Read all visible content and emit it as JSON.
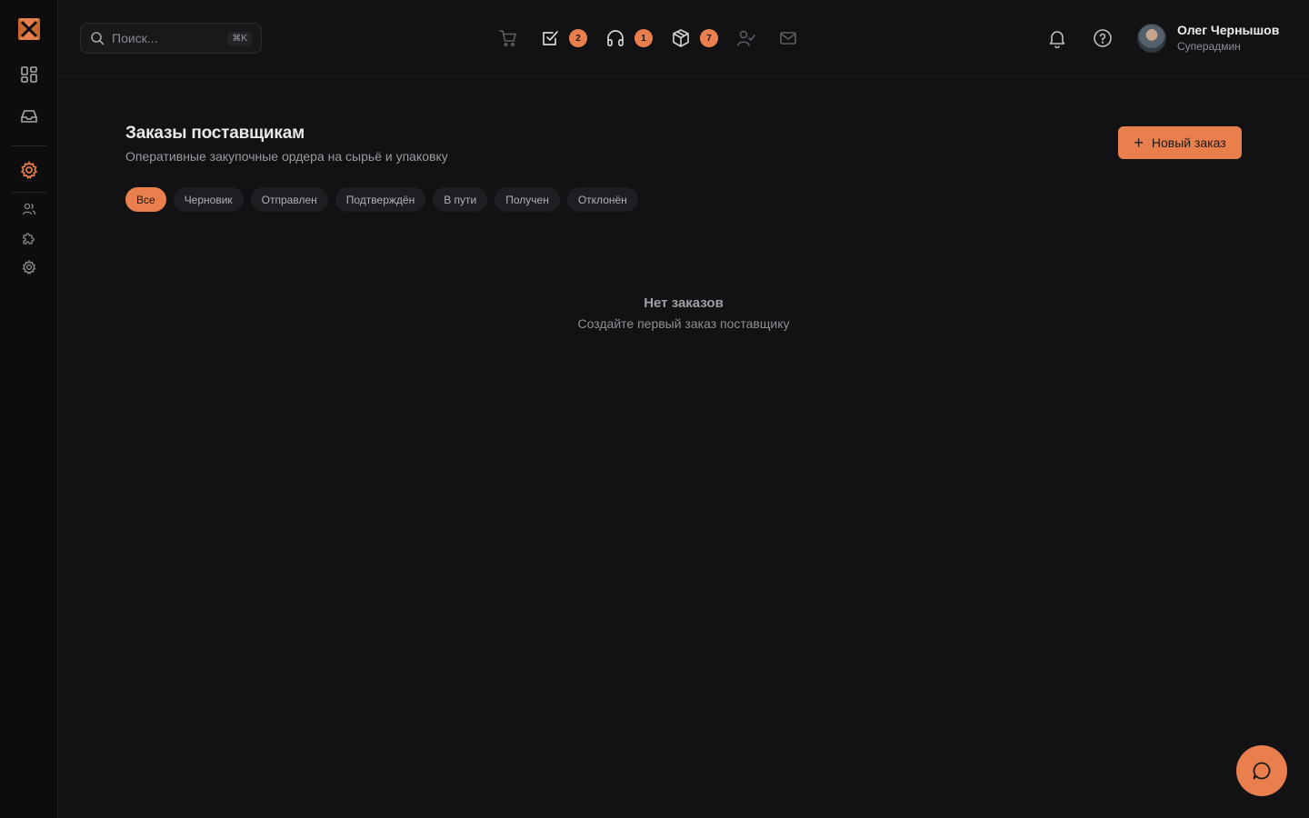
{
  "colors": {
    "accent": "#e87f4d",
    "background": "#121214",
    "sidebar": "#0d0d0f"
  },
  "sidebar": {
    "logo_icon": "brand-logo-icon",
    "items": [
      {
        "name": "dashboard",
        "icon": "dashboard-grid-icon"
      },
      {
        "name": "inbox",
        "icon": "inbox-tray-icon"
      },
      {
        "name": "settings-active",
        "icon": "gear-icon"
      },
      {
        "name": "users",
        "icon": "users-icon"
      },
      {
        "name": "integrations",
        "icon": "puzzle-icon"
      },
      {
        "name": "settings",
        "icon": "gear-icon"
      }
    ]
  },
  "header": {
    "search": {
      "placeholder": "Поиск...",
      "shortcut": "⌘K"
    },
    "nav_icons": [
      {
        "name": "cart",
        "icon": "shopping-cart-icon",
        "badge": ""
      },
      {
        "name": "tasks",
        "icon": "checkbox-icon",
        "badge": "2"
      },
      {
        "name": "support",
        "icon": "headphones-icon",
        "badge": "1"
      },
      {
        "name": "packages",
        "icon": "package-icon",
        "badge": "7"
      },
      {
        "name": "approvals",
        "icon": "user-check-icon",
        "badge": ""
      },
      {
        "name": "mail",
        "icon": "mail-icon",
        "badge": ""
      }
    ],
    "notifications_icon": "bell-icon",
    "help_icon": "help-circle-icon",
    "user": {
      "name": "Олег Чернышов",
      "role": "Суперадмин"
    }
  },
  "main": {
    "title": "Заказы поставщикам",
    "subtitle": "Оперативные закупочные ордера на сырьё и упаковку",
    "new_button": {
      "icon": "plus-icon",
      "label": "Новый заказ"
    },
    "filters": [
      "Все",
      "Черновик",
      "Отправлен",
      "Подтверждён",
      "В пути",
      "Получен",
      "Отклонён"
    ],
    "active_filter": "Все",
    "empty_state": {
      "title": "Нет заказов",
      "subtitle": "Создайте первый заказ поставщику"
    }
  },
  "chat_button_icon": "chat-bubble-icon"
}
